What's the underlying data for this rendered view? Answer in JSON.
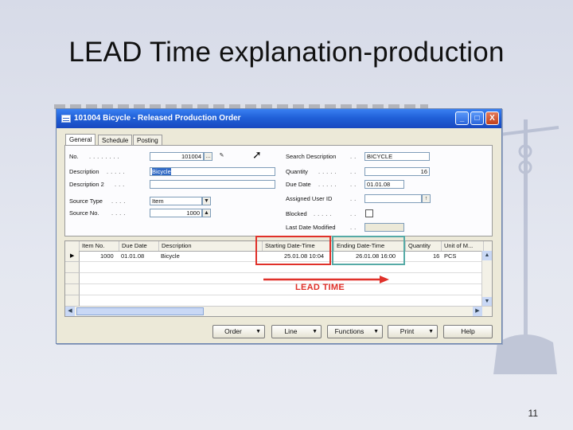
{
  "slide": {
    "title": "LEAD Time explanation-production",
    "page_number": "11"
  },
  "window": {
    "title": "101004 Bicycle - Released Production Order",
    "min_label": "_",
    "max_label": "□",
    "close_label": "X"
  },
  "tabs": [
    {
      "label": "General"
    },
    {
      "label": "Schedule"
    },
    {
      "label": "Posting"
    }
  ],
  "left_fields": {
    "no_label": "No.",
    "no_value": "101004",
    "desc_label": "Description",
    "desc_value": "Bicycle",
    "desc2_label": "Description 2",
    "desc2_value": "",
    "source_type_label": "Source Type",
    "source_type_value": "Item",
    "source_no_label": "Source No.",
    "source_no_value": "1000"
  },
  "right_fields": {
    "search_desc_label": "Search Description",
    "search_desc_value": "BICYCLE",
    "quantity_label": "Quantity",
    "quantity_value": "16",
    "due_date_label": "Due Date",
    "due_date_value": "01.01.08",
    "assigned_user_label": "Assigned User ID",
    "assigned_user_value": "",
    "blocked_label": "Blocked",
    "last_date_label": "Last Date Modified",
    "last_date_value": ""
  },
  "grid": {
    "columns": [
      "Item No.",
      "Due Date",
      "Description",
      "Starting Date-Time",
      "Ending Date-Time",
      "Quantity",
      "Unit of M..."
    ],
    "rows": [
      [
        "1000",
        "01.01.08",
        "Bicycle",
        "25.01.08 10:04",
        "26.01.08 16:00",
        "16",
        "PCS"
      ]
    ]
  },
  "annotation": {
    "lead_time": "LEAD TIME"
  },
  "buttons": {
    "order": "Order",
    "line": "Line",
    "functions": "Functions",
    "print": "Print",
    "help": "Help"
  },
  "colors": {
    "highlight_red": "#e0312a",
    "highlight_teal": "#56aaa6",
    "title_bar": "#2060d8"
  }
}
